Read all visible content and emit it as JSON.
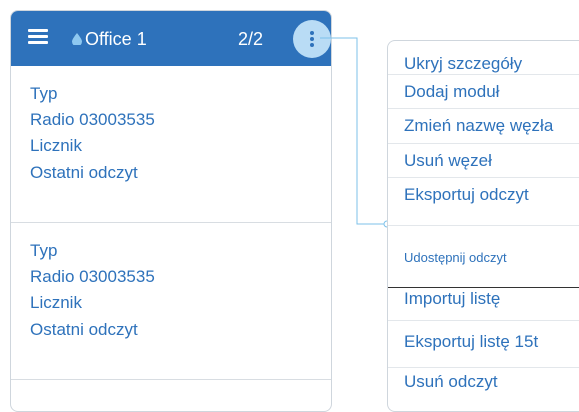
{
  "header": {
    "title": "Office 1",
    "counter": "2/2",
    "menu_icon": "hamburger-icon",
    "node_icon": "water-drop-icon",
    "more_icon": "more-vertical-icon",
    "accent": "#2e72bb"
  },
  "items": [
    {
      "type": "Typ",
      "radio": "Radio 03003535",
      "meter": "Licznik",
      "last_reading": "Ostatni odczyt"
    },
    {
      "type": "Typ",
      "radio": "Radio 03003535",
      "meter": "Licznik",
      "last_reading": "Ostatni odczyt"
    }
  ],
  "context_menu": {
    "items": [
      "Ukryj szczegóły",
      "Dodaj moduł",
      "Zmień nazwę węzła",
      "Usuń węzeł",
      "Eksportuj odczyt",
      "Udostępnij odczyt",
      "Importuj listę",
      "Eksportuj listę 15t",
      "Usuń odczyt"
    ]
  }
}
